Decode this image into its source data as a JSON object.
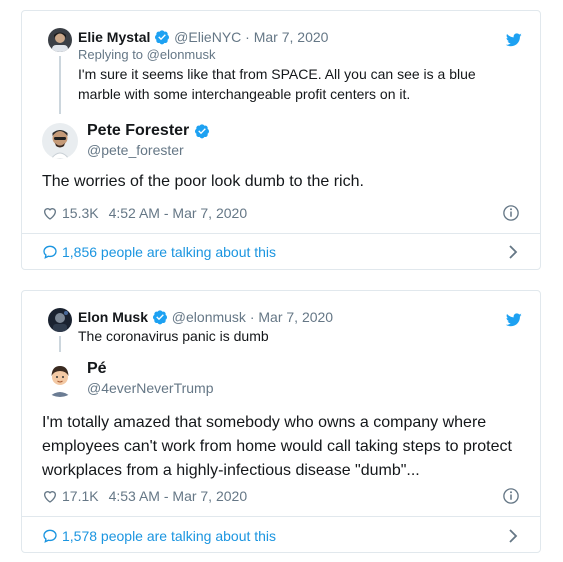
{
  "tweets": [
    {
      "quoted": {
        "name": "Elie Mystal",
        "handle": "@ElieNYC",
        "date_line": " · Mar 7, 2020",
        "reply_line": "Replying to @elonmusk",
        "text": "I'm sure it seems like that from SPACE. All you can see is a blue marble with some interchangeable profit centers on it."
      },
      "author": {
        "name": "Pete Forester",
        "handle": "@pete_forester"
      },
      "text": "The worries of the poor look dumb to the rich.",
      "likes": "15.3K",
      "time": "4:52 AM - Mar 7, 2020",
      "talking": "1,856 people are talking about this"
    },
    {
      "quoted": {
        "name": "Elon Musk",
        "handle": "@elonmusk",
        "date_line": " · Mar 7, 2020",
        "text": "The coronavirus panic is dumb"
      },
      "author": {
        "name": "Pé",
        "handle": "@4everNeverTrump"
      },
      "text": "I'm totally amazed that somebody who owns a company where employees can't work from home would call taking steps to protect workplaces from a highly-infectious disease \"dumb\"...",
      "likes": "17.1K",
      "time": "4:53 AM - Mar 7, 2020",
      "talking": "1,578 people are talking about this"
    }
  ],
  "colors": {
    "accent": "#1da1f2",
    "link": "#1b95e0",
    "muted": "#657786",
    "border": "#e1e8ed"
  },
  "icons": [
    "twitter-bird-icon",
    "verified-badge-icon",
    "heart-icon",
    "info-icon",
    "comment-bubble-icon",
    "chevron-right-icon"
  ]
}
